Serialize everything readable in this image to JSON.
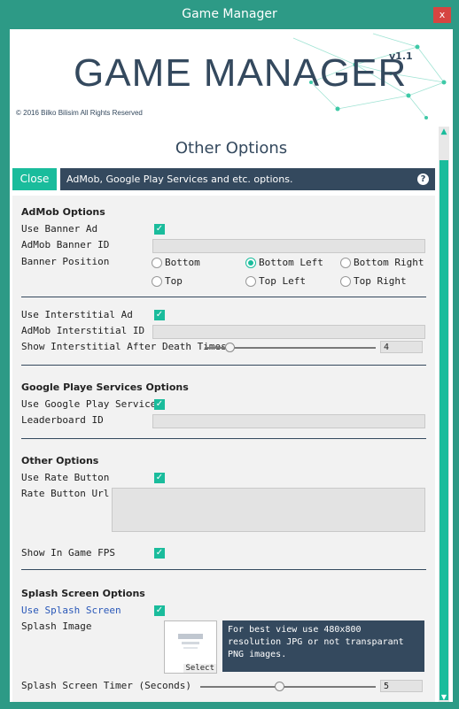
{
  "window": {
    "title": "Game Manager",
    "close_label": "x"
  },
  "banner": {
    "title": "GAME MANAGER",
    "version": "v1.1",
    "copyright": "© 2016 Bilko Bilisim All Rights Reserved"
  },
  "page_title": "Other Options",
  "toolbar": {
    "close_label": "Close",
    "description": "AdMob, Google Play Services and etc. options.",
    "help_label": "?"
  },
  "admob": {
    "header": "AdMob Options",
    "use_banner_label": "Use Banner Ad",
    "banner_id_label": "AdMob Banner ID",
    "banner_position_label": "Banner Position",
    "positions": [
      "Bottom",
      "Bottom Left",
      "Bottom Right",
      "Top",
      "Top Left",
      "Top Right"
    ],
    "selected_position": "Bottom Left",
    "use_interstitial_label": "Use Interstitial Ad",
    "interstitial_id_label": "AdMob Interstitial ID",
    "show_after_label": "Show Interstitial After Death Times",
    "show_after_value": "4"
  },
  "google_play": {
    "header": "Google Playe Services Options",
    "use_label": "Use Google Play Services",
    "leaderboard_label": "Leaderboard ID"
  },
  "other": {
    "header": "Other Options",
    "use_rate_label": "Use Rate Button",
    "rate_url_label": "Rate Button Url",
    "show_fps_label": "Show In Game FPS"
  },
  "splash": {
    "header": "Splash Screen Options",
    "use_label": "Use Splash Screen",
    "image_label": "Splash Image",
    "select_label": "Select",
    "tip": "For best view use 480x800 resolution JPG or not transparant PNG images.",
    "timer_label": "Splash Screen Timer (Seconds)",
    "timer_value": "5"
  },
  "colors": {
    "accent": "#1abc9c",
    "dark": "#34495e",
    "title_bar": "#2d9a86"
  }
}
